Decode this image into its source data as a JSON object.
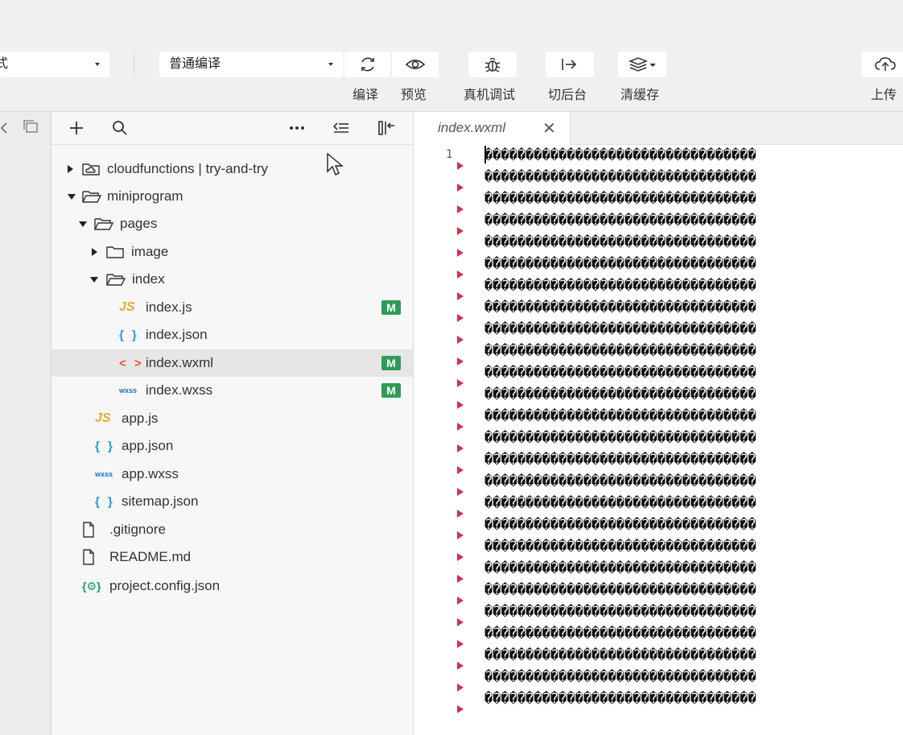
{
  "toolbar": {
    "mode_value": "式",
    "compile_value": "普通编译",
    "buttons": {
      "compile": "编译",
      "preview": "预览",
      "remote_debug": "真机调试",
      "background": "切后台",
      "clear_cache": "清缓存",
      "upload": "上传"
    }
  },
  "explorer": {
    "tree": [
      {
        "label": "cloudfunctions | try-and-try",
        "type": "cloud-folder",
        "expanded": false
      },
      {
        "label": "miniprogram",
        "type": "folder",
        "expanded": true
      },
      {
        "label": "pages",
        "type": "folder",
        "expanded": true
      },
      {
        "label": "image",
        "type": "folder",
        "expanded": false
      },
      {
        "label": "index",
        "type": "folder",
        "expanded": true
      },
      {
        "label": "index.js",
        "type": "js",
        "badge": "M"
      },
      {
        "label": "index.json",
        "type": "json"
      },
      {
        "label": "index.wxml",
        "type": "wxml",
        "badge": "M",
        "selected": true
      },
      {
        "label": "index.wxss",
        "type": "wxss",
        "badge": "M"
      },
      {
        "label": "app.js",
        "type": "js"
      },
      {
        "label": "app.json",
        "type": "json"
      },
      {
        "label": "app.wxss",
        "type": "wxss"
      },
      {
        "label": "sitemap.json",
        "type": "json"
      },
      {
        "label": ".gitignore",
        "type": "file"
      },
      {
        "label": "README.md",
        "type": "file"
      },
      {
        "label": "project.config.json",
        "type": "config"
      }
    ],
    "icon_text": {
      "js": "JS",
      "json": "{ }",
      "wxml": "< >",
      "wxss": "wxss",
      "config": "{⚙}"
    }
  },
  "editor": {
    "tab_name": "index.wxml",
    "tab_close": "✕",
    "line_number": "1",
    "garbled_line": "���������������������������������",
    "line_count": 26
  },
  "colors": {
    "badge_green": "#2e9b58",
    "gutter_marker": "#d0344a",
    "js_icon": "#e8a92b",
    "json_icon": "#1a9ad8",
    "wxml_icon": "#e5572a"
  }
}
